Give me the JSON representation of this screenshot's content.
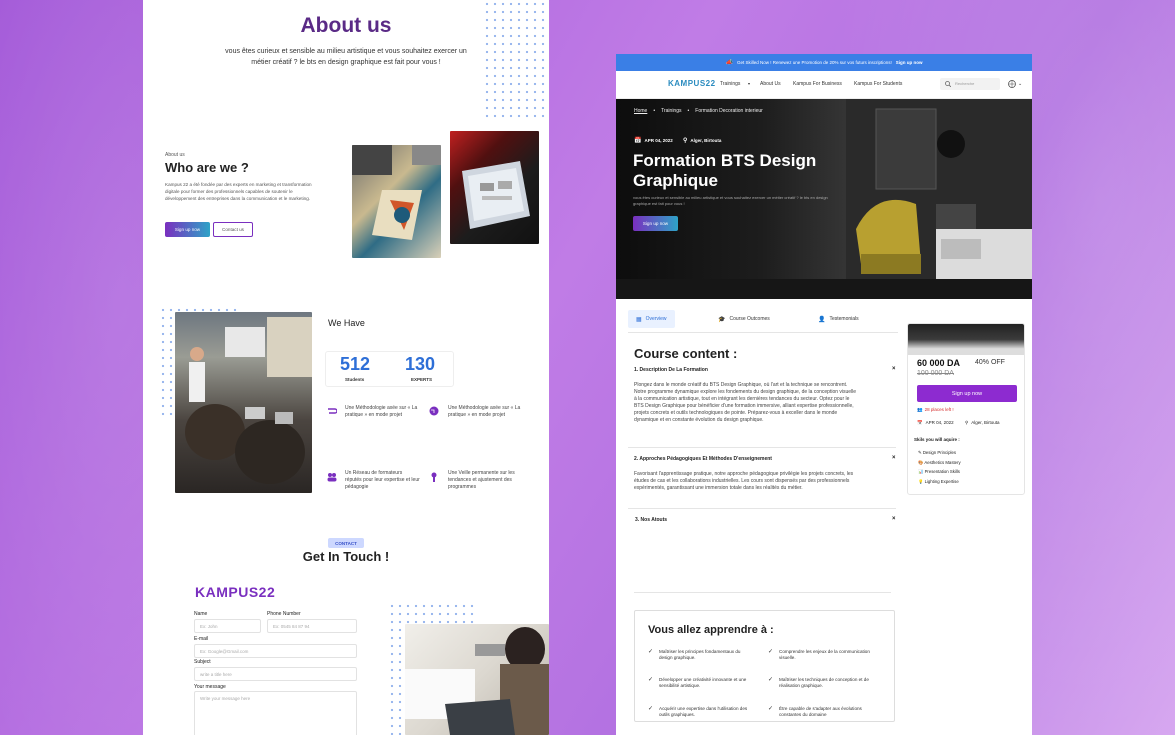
{
  "left": {
    "about_title": "About us",
    "about_text": "vous êtes curieux et sensible au milieu artistique et vous souhaitez exercer un métier créatif ? le bts en design graphique est fait pour vous !",
    "who_small": "About us",
    "who_title": "Who are we ?",
    "who_text": "Kampus 22 a été fondée par des experts en marketing et transformation digitale pour former des professionnels capables de soutenir le développement des entreprises dans la communication et le marketing.",
    "signup_label": "Sign up now",
    "contact_label": "Contact us",
    "we_have": "We Have",
    "stats": [
      {
        "number": "512",
        "label": "Students"
      },
      {
        "number": "130",
        "label": "EXPERTS"
      }
    ],
    "features": [
      "Une Méthodologie axée sur « La pratique » en mode projet",
      "Une Méthodologie axée sur « La pratique » en mode projet",
      "Un Réseau de formateurs réputés pour leur expertise et leur pédagogie",
      "Une Veille permanente sur les tendances et ajustement des programmes"
    ],
    "contact_badge": "CONTACT",
    "get_in_touch": "Get In Touch !",
    "logo": "KAMPUS22",
    "form": {
      "name_label": "Name",
      "name_placeholder": "Ex: John",
      "phone_label": "Phone Number",
      "phone_placeholder": "Ex: 0545 84 87 94",
      "email_label": "E-mail",
      "email_placeholder": "Ex: Google@Gmail.com",
      "subject_label": "Subject",
      "subject_placeholder": "write a title here",
      "message_label": "Your message",
      "message_placeholder": "Write your message here"
    }
  },
  "right": {
    "topbar_text": "Get Skilled Now ! Renewez une Promotion de 20% sur vos futurs inscriptions!",
    "topbar_link": "Sign up now",
    "nav": {
      "logo": "KAMPUS22",
      "items": [
        "Trainings",
        "About Us",
        "Kampus For Business",
        "Kampus For Students"
      ],
      "search_placeholder": "Recherche"
    },
    "breadcrumb": [
      "Home",
      "Trainings",
      "Formation Decoration interieur"
    ],
    "hero": {
      "date": "APR 04, 2022",
      "location": "Alger, Birtouta",
      "title": "Formation BTS Design Graphique",
      "text": "vous êtes curieux et sensible au milieu artistique et vous souhaitez exercer un métier créatif ? le bts en design graphique est fait pour vous !",
      "button": "Sign up now"
    },
    "tabs": [
      "Overview",
      "Course Outcomes",
      "Testemonials"
    ],
    "course_title": "Course content :",
    "sections": [
      {
        "title": "1. Description De La Formation",
        "text": "Plongez dans le monde créatif du BTS Design Graphique, où l'art et la technique se rencontrent. Notre programme dynamique explore les fondements du design graphique, de la conception visuelle à la communication artistique, tout en intégrant les dernières tendances du secteur. Optez pour le BTS Design Graphique pour bénéficier d'une formation immersive, alliant expertise professionnelle, projets concrets et outils technologiques de pointe. Préparez-vous à exceller dans le monde dynamique et en constante évolution du design graphique."
      },
      {
        "title": "2. Approches Pédagogiques Et Méthodes D'enseignement",
        "text": "Favorisant l'apprentissage pratique, notre approche pédagogique privilégie les projets concrets, les études de cas et les collaborations industrielles. Les cours sont dispensés par des professionnels expérimentés, garantissant une immersion totale dans les réalités du métier."
      },
      {
        "title": "3. Nos Atouts",
        "text": ""
      }
    ],
    "card": {
      "price": "60 000 DA",
      "discount": "40% OFF",
      "old_price": "100 000 DA",
      "button": "Sign up now",
      "places_left": "28 places left !",
      "date": "APR 04, 2022",
      "location": "Alger, Birtouta",
      "skills_title": "Skils you will aquire :",
      "skills": [
        "Design Principles",
        "Aesthetics Mastery",
        "Presentation Skills",
        "Lighting Expertise"
      ]
    },
    "learn": {
      "title": "Vous allez apprendre à :",
      "items": [
        "Maîtriser les principes fondamentaux du design graphique.",
        "Comprendre les enjeux de la communication visuelle.",
        "Développer une créativité innovante et une sensibilité artistique.",
        "Maîtriser les techniques de conception et de réalisation graphique.",
        "Acquérir une expertise dans l'utilisation des outils graphiques.",
        "Être capable de s'adapter aux évolutions constantes du domaine"
      ]
    }
  },
  "colors": {
    "primary": "#7a2fbf",
    "accent_blue": "#3a7fe6",
    "title_purple": "#5a2a86",
    "stat_blue": "#2e6fd7"
  }
}
